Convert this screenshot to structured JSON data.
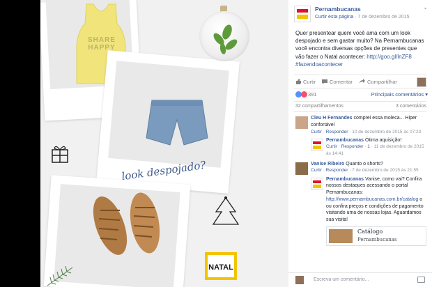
{
  "image": {
    "tshirt_text": "SHARE HAPPY",
    "tagline": "look despojado?",
    "badge_label": "NATAL"
  },
  "post": {
    "page_name": "Pernambucanas",
    "like_page": "Curtir esta página",
    "separator": "·",
    "date": "7 de dezembro de 2015",
    "menu_icon": "chevron-down-icon",
    "text_1": "Quer presentear quem você ama com um look despojado e sem gastar muito? Na Pernambucanas você encontra diversas opções de presentes que vão fazer o Natal acontecer:",
    "link": "http://goo.gl/lnZF8",
    "hashtag": "#fazendoacontecer"
  },
  "actions": {
    "like": "Curtir",
    "comment": "Comentar",
    "share": "Compartilhar"
  },
  "reactions": {
    "count": "391",
    "sort_label": "Principais comentários"
  },
  "stats": {
    "shares": "32 compartilhamentos",
    "comments": "3 comentários"
  },
  "comments": [
    {
      "author": "Cleu H Fernandes",
      "text": "comprei essa moleca... Hiper confortável",
      "like": "Curtir",
      "reply": "Responder",
      "date": "10 de dezembro de 2015 às 07:23",
      "replies": [
        {
          "author": "Pernambucanas",
          "text": "Ótima aquisição!",
          "like": "Curtir",
          "reply": "Responder",
          "likes": "1",
          "date": "11 de dezembro de 2015 às 14:41"
        }
      ]
    },
    {
      "author": "Vanise Ribeiro",
      "text": "Quanto o shorts?",
      "like": "Curtir",
      "reply": "Responder",
      "date": "7 de dezembro de 2015 às 21:55",
      "replies": [
        {
          "author": "Pernambucanas",
          "text_1": "Vanise, como vai? Confira nossos destaques acessando o portal Pernambucanas:",
          "link": "http://www.pernambucanas.com.br/catalog",
          "text_2": "o ou confira preços e condições de pagamento visitando uma de nossas lojas. Aguardamos sua visita!",
          "card_title": "Catálogo",
          "card_subtitle": "Pernambucanas"
        }
      ]
    }
  ],
  "composer": {
    "placeholder": "Escreva um comentário..."
  },
  "colors": {
    "link": "#365899",
    "muted": "#90949c",
    "brand_red": "#e0122b",
    "brand_yellow": "#f2c400"
  }
}
